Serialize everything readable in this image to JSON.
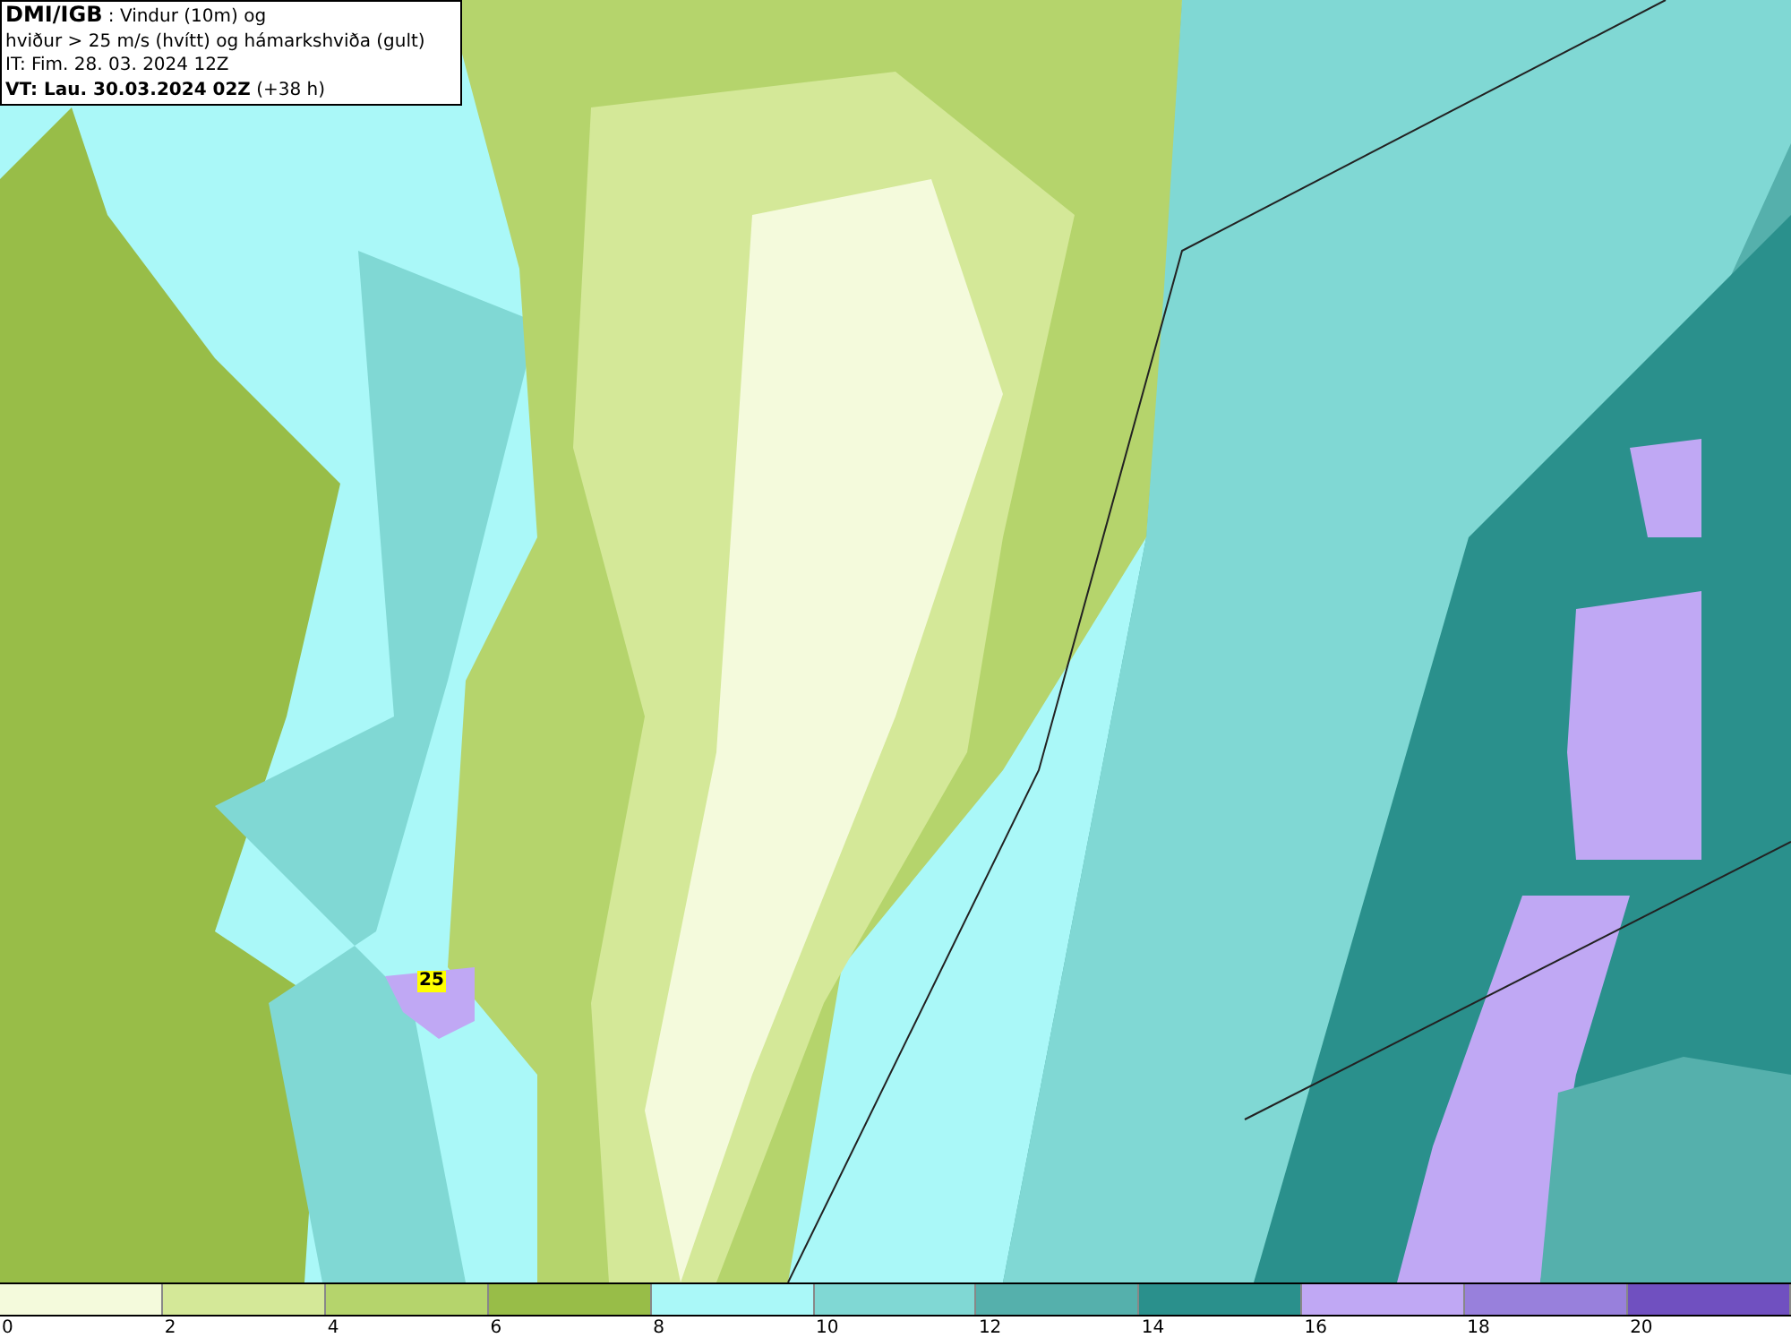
{
  "header": {
    "lines": [
      {
        "kind": "title",
        "text": "**DMI/IGB** : Vindur (10m) og"
      },
      {
        "kind": "plain",
        "text": "hviður > 25 m/s (hvítt) og hámarkshviða (gult)"
      },
      {
        "kind": "plain",
        "text": "IT: Fim. 28. 03. 2024 12Z"
      },
      {
        "kind": "plain",
        "text": "**VT: Lau. 30.03.2024 02Z** (+38 h)"
      }
    ]
  },
  "map": {
    "gust_labels": [
      {
        "text": "25"
      }
    ]
  },
  "legend": {
    "bins": [
      {
        "label": "0",
        "color": "#f4fadc"
      },
      {
        "label": "2",
        "color": "#d4e898"
      },
      {
        "label": "4",
        "color": "#b5d46c"
      },
      {
        "label": "6",
        "color": "#98bd48"
      },
      {
        "label": "8",
        "color": "#aaf8f8"
      },
      {
        "label": "10",
        "color": "#80d8d4"
      },
      {
        "label": "12",
        "color": "#55b0ac"
      },
      {
        "label": "14",
        "color": "#2a908c"
      },
      {
        "label": "16",
        "color": "#c0a8f4"
      },
      {
        "label": "18",
        "color": "#9880dc"
      },
      {
        "label": "20",
        "color": "#7050c0"
      }
    ]
  }
}
